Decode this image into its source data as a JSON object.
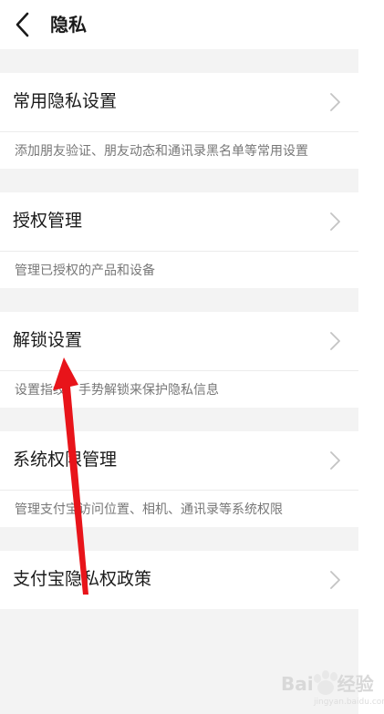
{
  "header": {
    "title": "隐私",
    "back_icon": "chevron-left-icon"
  },
  "sections": [
    {
      "title": "常用隐私设置",
      "description": "添加朋友验证、朋友动态和通讯录黑名单等常用设置"
    },
    {
      "title": "授权管理",
      "description": "管理已授权的产品和设备"
    },
    {
      "title": "解锁设置",
      "description": "设置指纹、手势解锁来保护隐私信息"
    },
    {
      "title": "系统权限管理",
      "description": "管理支付宝访问位置、相机、通讯录等系统权限"
    },
    {
      "title": "支付宝隐私权政策"
    }
  ],
  "annotation": {
    "type": "red-arrow",
    "color": "#e8141a",
    "points_to": "解锁设置"
  },
  "watermark": {
    "brand": "Bai",
    "brand_cn": "经验",
    "url": "jingyan.baidu.com"
  },
  "colors": {
    "background": "#f3f3f3",
    "card": "#ffffff",
    "title_text": "#1a1a1a",
    "desc_text": "#777777",
    "chevron": "#c4c4c4"
  }
}
